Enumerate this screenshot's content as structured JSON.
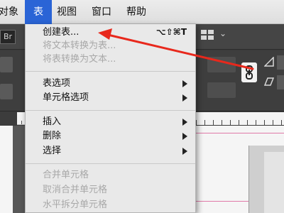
{
  "menubar": {
    "items": [
      {
        "label": "对象"
      },
      {
        "label": "表",
        "active": true
      },
      {
        "label": "视图"
      },
      {
        "label": "窗口"
      },
      {
        "label": "帮助"
      }
    ]
  },
  "toolbar": {
    "bridge_badge": "Br"
  },
  "table_menu": {
    "items": [
      {
        "label": "创建表...",
        "shortcut": "⌥⇧⌘T",
        "enabled": true
      },
      {
        "label": "将文本转换为表...",
        "enabled": false
      },
      {
        "label": "将表转换为文本...",
        "enabled": false
      },
      {
        "label": "表选项",
        "submenu": true,
        "enabled": true
      },
      {
        "label": "单元格选项",
        "submenu": true,
        "enabled": true
      },
      {
        "label": "插入",
        "submenu": true,
        "enabled": true
      },
      {
        "label": "删除",
        "submenu": true,
        "enabled": true
      },
      {
        "label": "选择",
        "submenu": true,
        "enabled": true
      },
      {
        "label": "合并单元格",
        "enabled": false
      },
      {
        "label": "取消合并单元格",
        "enabled": false
      },
      {
        "label": "水平拆分单元格",
        "enabled": false
      }
    ]
  },
  "annotation": {
    "arrow_color": "#e8281c",
    "points_to": "创建表..."
  },
  "colors": {
    "menu_highlight": "#2a64d6",
    "menu_background": "#e9e9e9",
    "disabled_text": "#a8a8a8"
  }
}
